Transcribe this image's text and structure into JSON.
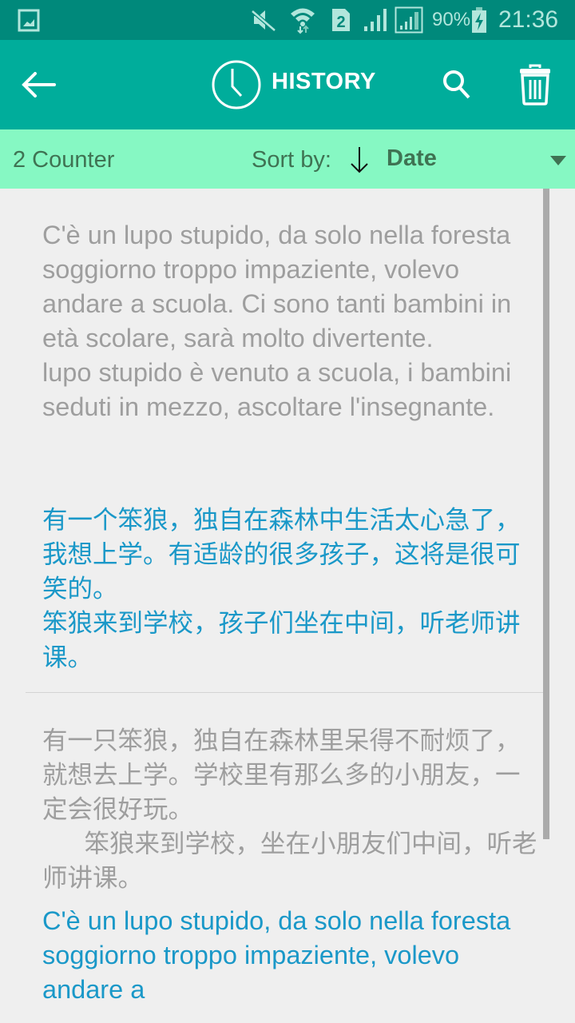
{
  "status_bar": {
    "battery": "90%",
    "time": "21:36",
    "sim_slot": "2",
    "icons": [
      "gallery-icon",
      "mute-icon",
      "wifi-icon",
      "sim-icon",
      "signal-icon",
      "signal-icon-2",
      "battery-charging-icon"
    ]
  },
  "app_bar": {
    "title": "HISTORY",
    "back_icon": "arrow-left-icon",
    "title_icon": "clock-icon",
    "search_icon": "search-icon",
    "delete_icon": "trash-icon"
  },
  "sort_bar": {
    "counter": "2 Counter",
    "sort_label": "Sort by:",
    "sort_direction_icon": "arrow-down-icon",
    "sort_value": "Date",
    "dropdown_icon": "triangle-down-icon"
  },
  "colors": {
    "status_bar": "#00897b",
    "app_bar": "#00ad9b",
    "sort_bar": "#86f8c3",
    "source_text": "#9e9e9e",
    "translation_text": "#1a98c8"
  },
  "history": [
    {
      "source": "C'è un lupo stupido, da solo nella foresta soggiorno troppo impaziente, volevo andare a scuola. Ci sono tanti bambini in età scolare, sarà molto divertente.\nlupo stupido è venuto a scuola, i bambini seduti in mezzo, ascoltare l'insegnante.",
      "translation": "有一个笨狼，独自在森林中生活太心急了，我想上学。有适龄的很多孩子，这将是很可笑的。\n笨狼来到学校，孩子们坐在中间，听老师讲课。"
    },
    {
      "source": "有一只笨狼，独自在森林里呆得不耐烦了，就想去上学。学校里有那么多的小朋友，一定会很好玩。\n      笨狼来到学校，坐在小朋友们中间，听老师讲课。",
      "translation": "C'è un lupo stupido, da solo nella foresta soggiorno troppo impaziente, volevo andare a"
    }
  ]
}
